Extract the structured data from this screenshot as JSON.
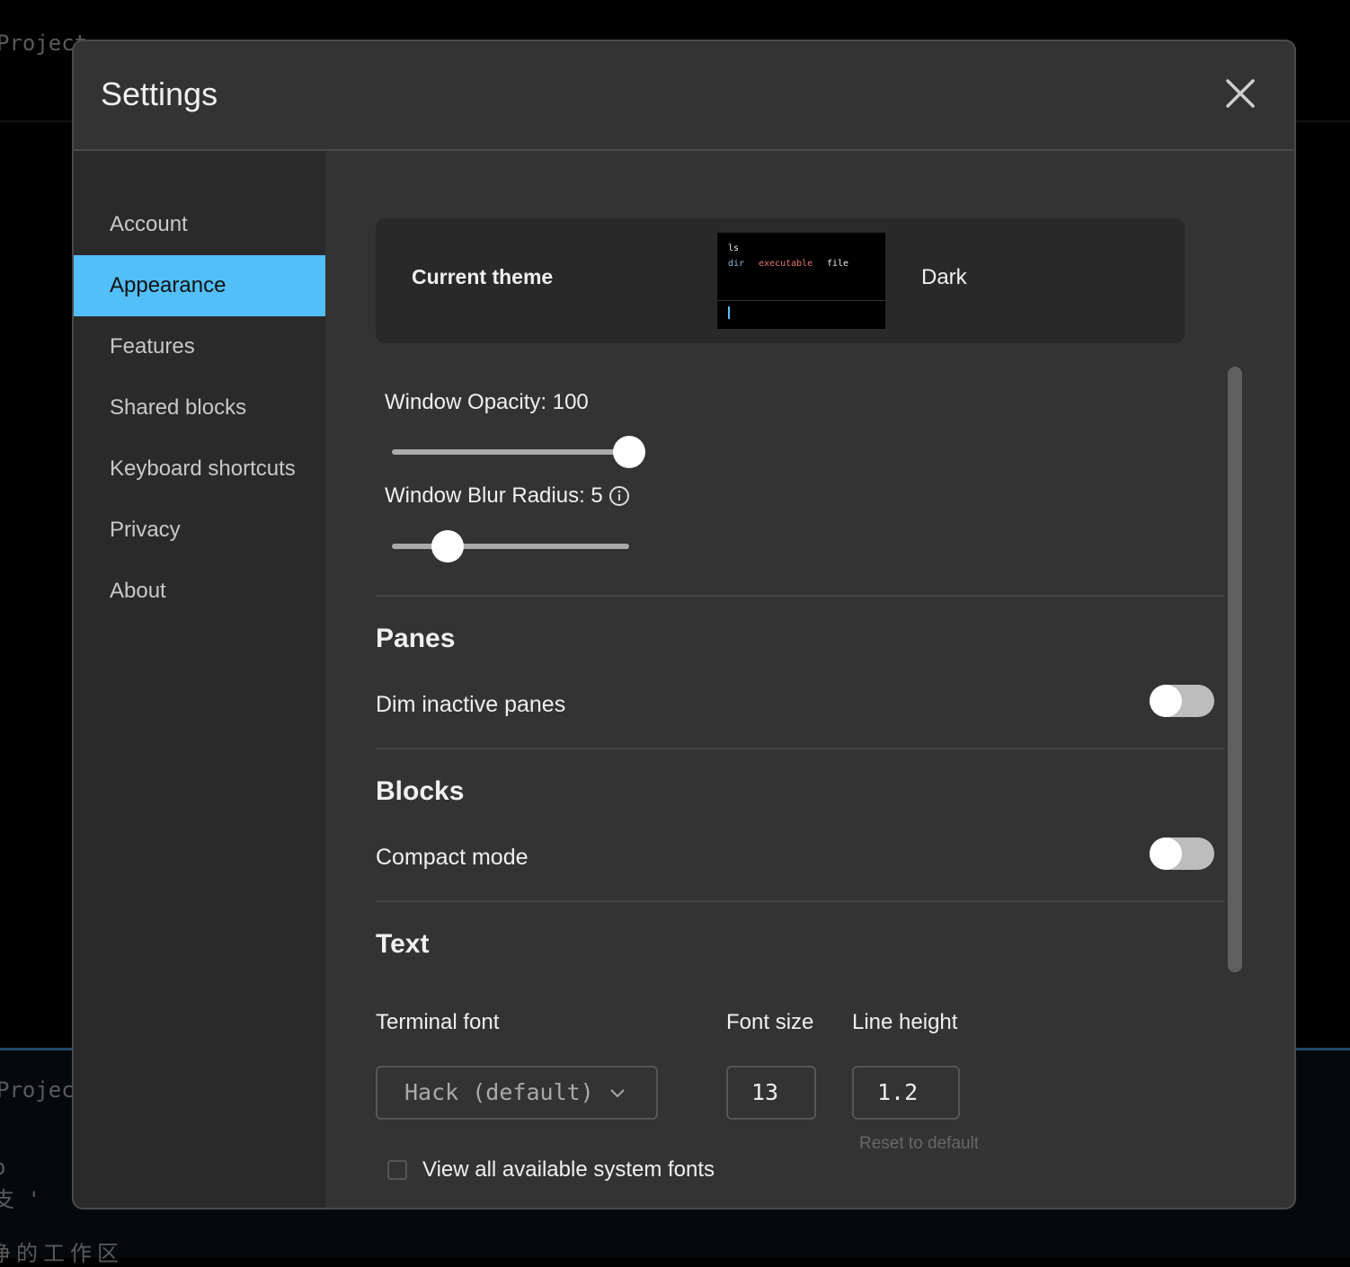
{
  "background": {
    "top_text": "Project",
    "bottom_text_1": "Projec",
    "bottom_text_2": "o",
    "bottom_text_3": "支 '",
    "bottom_text_4": "净的工作区"
  },
  "modal": {
    "title": "Settings",
    "close_icon": "close-x-icon"
  },
  "sidebar": {
    "items": [
      {
        "label": "Account",
        "active": false
      },
      {
        "label": "Appearance",
        "active": true
      },
      {
        "label": "Features",
        "active": false
      },
      {
        "label": "Shared blocks",
        "active": false
      },
      {
        "label": "Keyboard shortcuts",
        "active": false
      },
      {
        "label": "Privacy",
        "active": false
      },
      {
        "label": "About",
        "active": false
      }
    ]
  },
  "theme": {
    "label": "Current theme",
    "preview": {
      "line1": "ls",
      "dir": "dir",
      "exe": "executable",
      "file": "file"
    },
    "name": "Dark"
  },
  "window": {
    "opacity_label": "Window Opacity: 100",
    "opacity_value": 100,
    "blur_label": "Window Blur Radius: 5",
    "blur_value": 5,
    "info_icon": "info-circle-icon"
  },
  "panes": {
    "heading": "Panes",
    "dim_label": "Dim inactive panes",
    "dim_on": false
  },
  "blocks": {
    "heading": "Blocks",
    "compact_label": "Compact mode",
    "compact_on": false
  },
  "text": {
    "heading": "Text",
    "font_label": "Terminal font",
    "font_value": "Hack (default)",
    "size_label": "Font size",
    "size_value": "13",
    "lh_label": "Line height",
    "lh_value": "1.2",
    "reset_label": "Reset to default",
    "system_fonts_label": "View all available system fonts",
    "system_fonts_checked": false
  },
  "colors": {
    "accent": "#52bff9",
    "modal_bg": "#333333",
    "sidebar_bg": "#2a2a2a",
    "exe": "#e5786d",
    "dir": "#8fb8de"
  }
}
